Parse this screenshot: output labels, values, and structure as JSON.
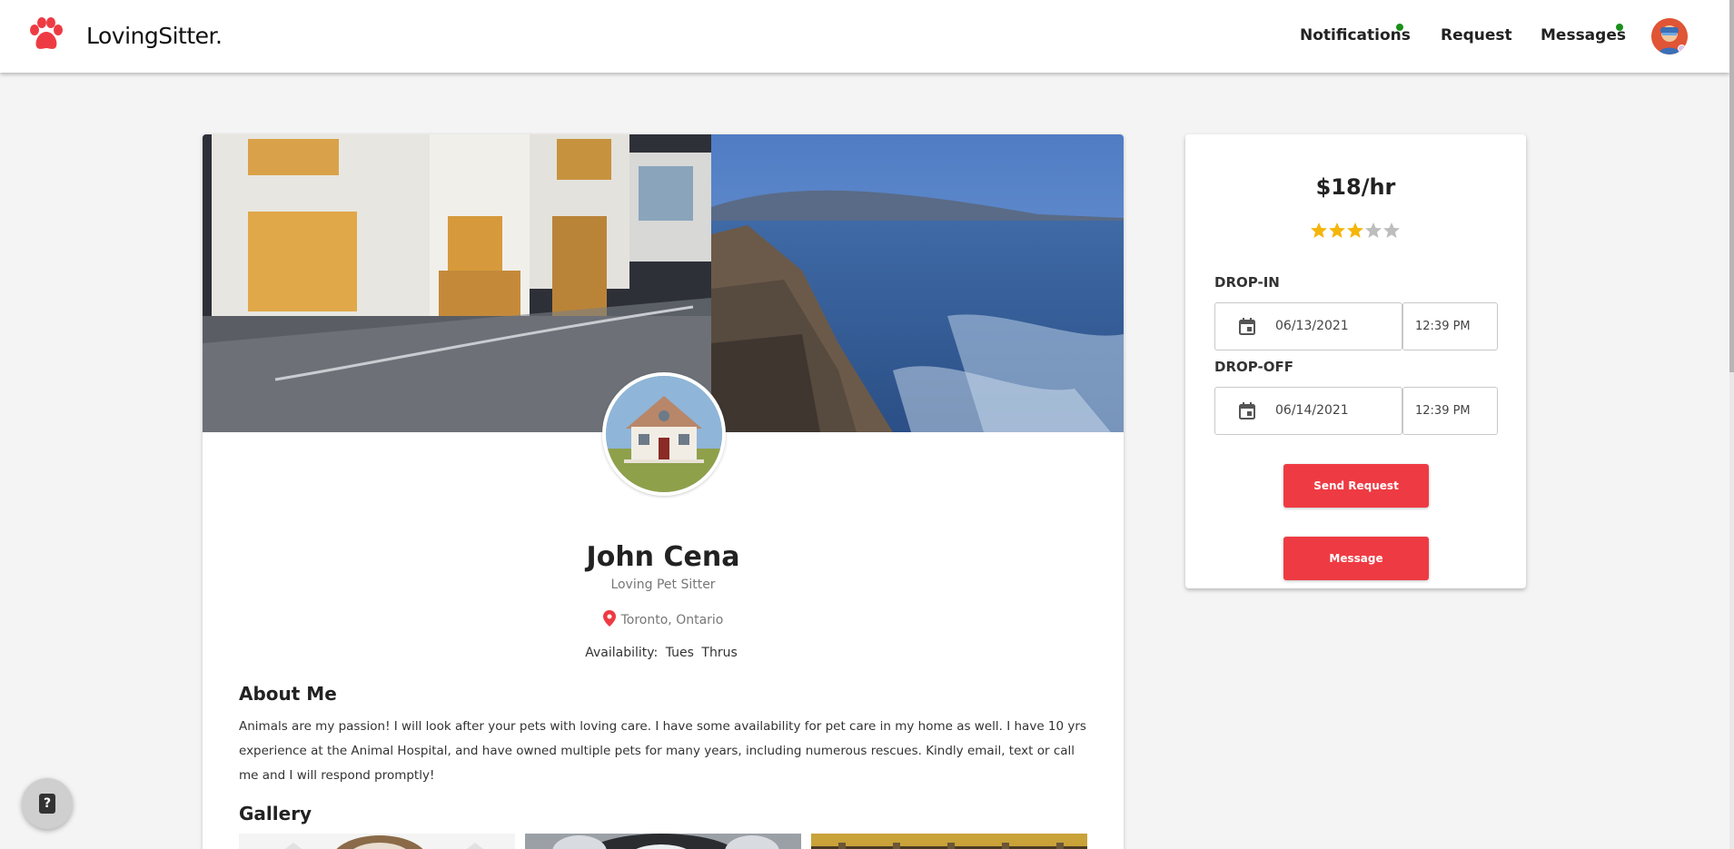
{
  "header": {
    "brand": "LovingSitter.",
    "nav": {
      "notifications": "Notifications",
      "request": "Request",
      "messages": "Messages"
    }
  },
  "profile": {
    "name": "John Cena",
    "subtitle": "Loving Pet Sitter",
    "location": "Toronto, Ontario",
    "availability_label": "Availability:",
    "availability_days": [
      "Tues",
      "Thrus"
    ],
    "about_title": "About Me",
    "about_text": "Animals are my passion! I will look after your pets with loving care. I have some availability for pet care in my home as well. I have 10 yrs experience at the Animal Hospital, and have owned multiple pets for many years, including numerous rescues. Kindly email, text or call me and I will respond promptly!",
    "gallery_title": "Gallery"
  },
  "booking": {
    "rate": "$18/hr",
    "rating": 3,
    "rating_max": 5,
    "drop_in": {
      "label": "DROP-IN",
      "date": "06/13/2021",
      "time": "12:39 PM"
    },
    "drop_off": {
      "label": "DROP-OFF",
      "date": "06/14/2021",
      "time": "12:39 PM"
    },
    "send_request_label": "Send Request",
    "message_label": "Message"
  },
  "help": {
    "icon_text": "?"
  },
  "colors": {
    "accent": "#ee3b43",
    "star_filled": "#f5b50a",
    "star_empty": "#bdbdbd",
    "status_online": "#1a8f1a",
    "background": "#f4f4f4"
  },
  "icons": {
    "logo": "paw-icon",
    "location": "map-pin-icon",
    "calendar": "calendar-icon",
    "help": "help-icon"
  }
}
